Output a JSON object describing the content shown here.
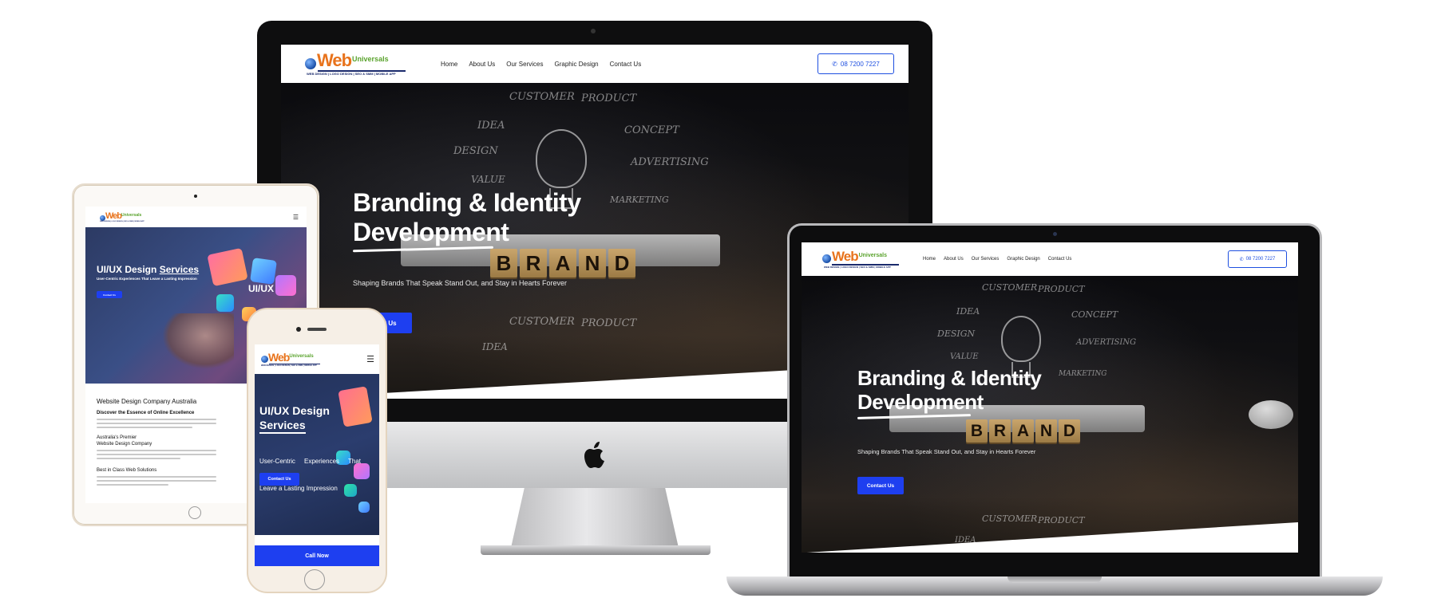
{
  "logo": {
    "web": "Web",
    "universals": "Universals",
    "tagline": "WEB DESIGN | LOGO DESIGN | SEO & SMM | MOBILE APP"
  },
  "nav": {
    "home": "Home",
    "about": "About Us",
    "services": "Our Services",
    "graphic": "Graphic Design",
    "contact": "Contact Us"
  },
  "phone": {
    "number": "08 7200 7227"
  },
  "hero": {
    "title_line1": "Branding & Identity",
    "title_line2": "Development",
    "subtitle": "Shaping Brands That Speak Stand Out, and Stay in Hearts Forever",
    "cta": "Contact Us",
    "cta_partial": "t Us",
    "brand_letters": [
      "B",
      "R",
      "A",
      "N",
      "D"
    ],
    "sketch_words": {
      "customer": "CUSTOMER",
      "product": "PRODUCT",
      "idea": "IDEA",
      "concept": "CONCEPT",
      "design": "DESIGN",
      "advertising": "ADVERTISING",
      "value": "VALUE",
      "marketing": "MARKETING"
    }
  },
  "ipad": {
    "hero_title_1": "UI/UX Design ",
    "hero_title_2": "Services",
    "hero_sub": "User-Centric Experiences That Leave a Lasting Impression",
    "hero_cta": "Contact Us",
    "uiux_tag": "UI/UX",
    "section_title": "Website Design Company Australia",
    "h1": "Discover the Essence of Online Excellence",
    "h2a": "Australia's Premier",
    "h2b": "Website Design Company",
    "h3": "Best in Class Web Solutions"
  },
  "iphone": {
    "title_1": "UI/UX Design",
    "title_2": "Services",
    "sub_1": "User-Centric     Experiences     That",
    "sub_2": "Leave a Lasting Impression",
    "cta": "Contact Us",
    "call": "Call Now"
  },
  "colors": {
    "accent": "#1e3ff0",
    "logo_orange": "#e8731c",
    "logo_green": "#5aa32d",
    "logo_navy": "#1a2a6c"
  }
}
